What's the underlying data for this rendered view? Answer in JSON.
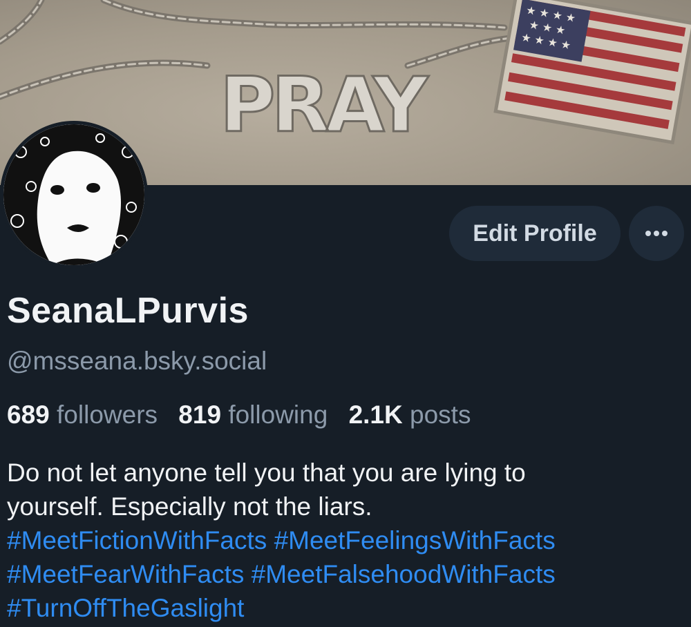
{
  "banner": {
    "label_text": "PRAY"
  },
  "actions": {
    "edit_profile": "Edit Profile",
    "more_icon": "ellipsis-icon"
  },
  "profile": {
    "display_name": "SeanaLPurvis",
    "handle": "@msseana.bsky.social"
  },
  "stats": {
    "followers_count": "689",
    "followers_label": "followers",
    "following_count": "819",
    "following_label": "following",
    "posts_count": "2.1K",
    "posts_label": "posts"
  },
  "bio": {
    "line1": "Do not let anyone tell you that you are lying to",
    "line2": "yourself. Especially not the liars.",
    "hashtags": [
      "#MeetFictionWithFacts",
      "#MeetFeelingsWithFacts",
      "#MeetFearWithFacts",
      "#MeetFalsehoodWithFacts",
      "#TurnOffTheGaslight"
    ]
  },
  "colors": {
    "background": "#161e27",
    "button_bg": "#1f2b39",
    "text_primary": "#f1f3f5",
    "text_secondary": "#8c9aaa",
    "link": "#2f8cf2"
  }
}
